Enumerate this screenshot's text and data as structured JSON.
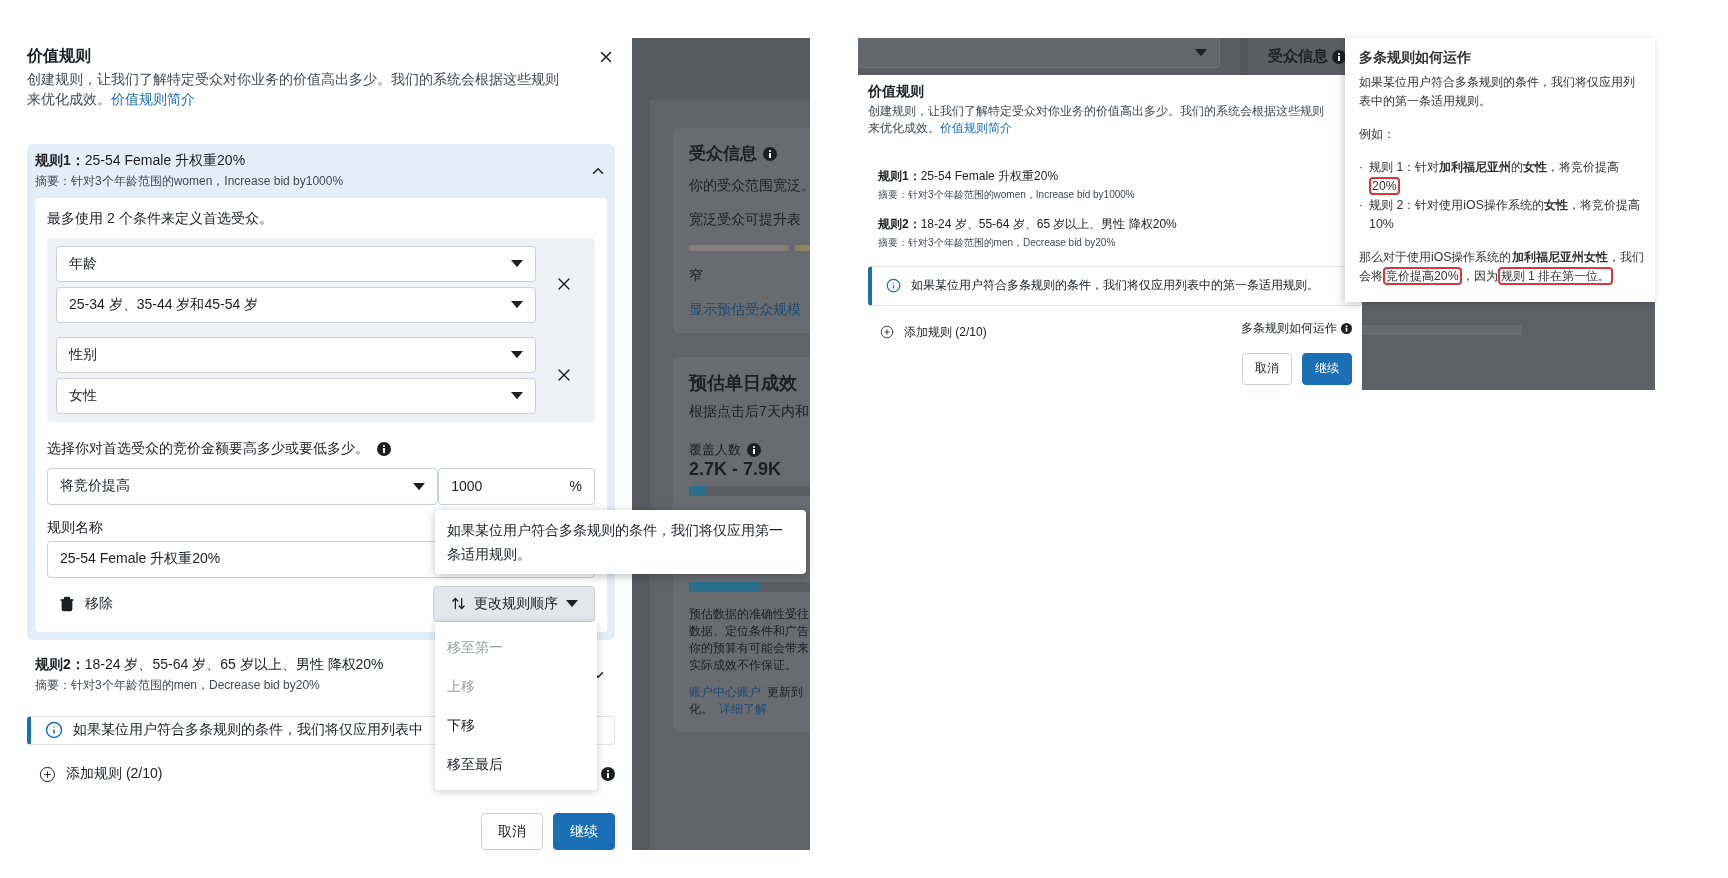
{
  "left_screen": {
    "modal": {
      "title": "价值规则",
      "description": "创建规则，让我们了解特定受众对你业务的价值高出多少。我们的系统会根据这些规则来优化成效。",
      "link": "价值规则简介",
      "rules": [
        {
          "heading": "**规则1：**25-54 Female 升权重20%",
          "summary": "摘要：针对3个年龄范围的women，Increase bid by1000%",
          "expanded": true,
          "editor": {
            "hint": "最多使用 2 个条件来定义首选受众。",
            "conditions": [
              {
                "field": "年龄",
                "value": "25-34 岁、35-44 岁和45-54 岁"
              },
              {
                "field": "性别",
                "value": "女性"
              }
            ],
            "bid_label": "选择你对首选受众的竞价金额要高多少或要低多少。",
            "bid_direction": "将竞价提高",
            "bid_amount": "1000",
            "bid_unit": "%",
            "name_label": "规则名称",
            "name_value": "25-54 Female 升权重20%",
            "remove": "移除",
            "reorder": "更改规则顺序"
          }
        },
        {
          "heading": "**规则2：**18-24 岁、55-64 岁、65 岁以上、男性 降权20%",
          "summary": "摘要：针对3个年龄范围的men，Decrease bid by20%",
          "expanded": false
        }
      ],
      "info_banner": "如果某位用户符合多条规则的条件，我们将仅应用列表中",
      "add_rule": "添加规则 (2/10)",
      "cancel": "取消",
      "continue": "继续"
    },
    "tooltip": "如果某位用户符合多条规则的条件，我们将仅应用第一条适用规则。",
    "reorder_menu": [
      {
        "label": "移至第一",
        "disabled": true
      },
      {
        "label": "上移",
        "disabled": true
      },
      {
        "label": "下移",
        "disabled": false
      },
      {
        "label": "移至最后",
        "disabled": false
      }
    ],
    "background": {
      "audience_card": {
        "title": "受众信息",
        "lines": [
          "你的受众范围宽泛。",
          "宽泛受众可提升表"
        ],
        "scale_label": "窄",
        "link": "显示预估受众规模"
      },
      "results_card": {
        "title": "预估单日成效",
        "subtitle": "根据点击后7天内和",
        "metric_label": "覆盖人数",
        "metric_value": "2.7K - 7.9K",
        "meters": [
          {
            "level": 0.08
          },
          {
            "level": 0.35
          }
        ],
        "note_lines": [
          "预估数据的准确性受往",
          "数据、定位条件和广告",
          "你的预算有可能会带来",
          "实际成效不作保证。"
        ],
        "footer_link": "账户中心账户",
        "footer_text": "更新到",
        "footer_end": "化。",
        "learn_more": "详细了解"
      }
    }
  },
  "right_screen": {
    "backdrop": {
      "audience_title": "受众信息"
    },
    "modal": {
      "title": "价值规则",
      "description": "创建规则，让我们了解特定受众对你业务的价值高出多少。我们的系统会根据这些规则来优化成效。",
      "link": "价值规则简介",
      "rules": [
        {
          "heading": "**规则1：**25-54 Female 升权重20%",
          "summary": "摘要：针对3个年龄范围的women，Increase bid by1000%"
        },
        {
          "heading": "**规则2：**18-24 岁、55-64 岁、65 岁以上、男性 降权20%",
          "summary": "摘要：针对3个年龄范围的men，Decrease bid by20%"
        }
      ],
      "info_banner": "如果某位用户符合多条规则的条件，我们将仅应用列表中的第一条适用规则。",
      "help_link": "多条规则如何运作",
      "add_rule": "添加规则 (2/10)",
      "cancel": "取消",
      "continue": "继续"
    },
    "popover": {
      "title": "多条规则如何运作",
      "intro": "如果某位用户符合多条规则的条件，我们将仅应用列表中的第一条适用规则。",
      "example_label": "例如：",
      "bullets": [
        {
          "bullet": "·",
          "segments": [
            {
              "text": "规则 1：针对**加利福尼亚州**的**女性**，将竞价提高 ",
              "boxed": false
            },
            {
              "text": "20%",
              "boxed": true
            }
          ]
        },
        {
          "bullet": "·",
          "segments": [
            {
              "text": "规则 2：针对使用iOS操作系统的**女性**，将竞价提高10%",
              "boxed": false
            }
          ]
        }
      ],
      "conclusion": [
        {
          "text": "那么对于使用iOS操作系统的**加利福尼亚州女性**，我们会将",
          "boxed": false
        },
        {
          "text": "竞价提高20%",
          "boxed": true
        },
        {
          "text": "，因为",
          "boxed": false
        },
        {
          "text": "规则 1 排在第一位。",
          "boxed": true
        }
      ]
    }
  }
}
